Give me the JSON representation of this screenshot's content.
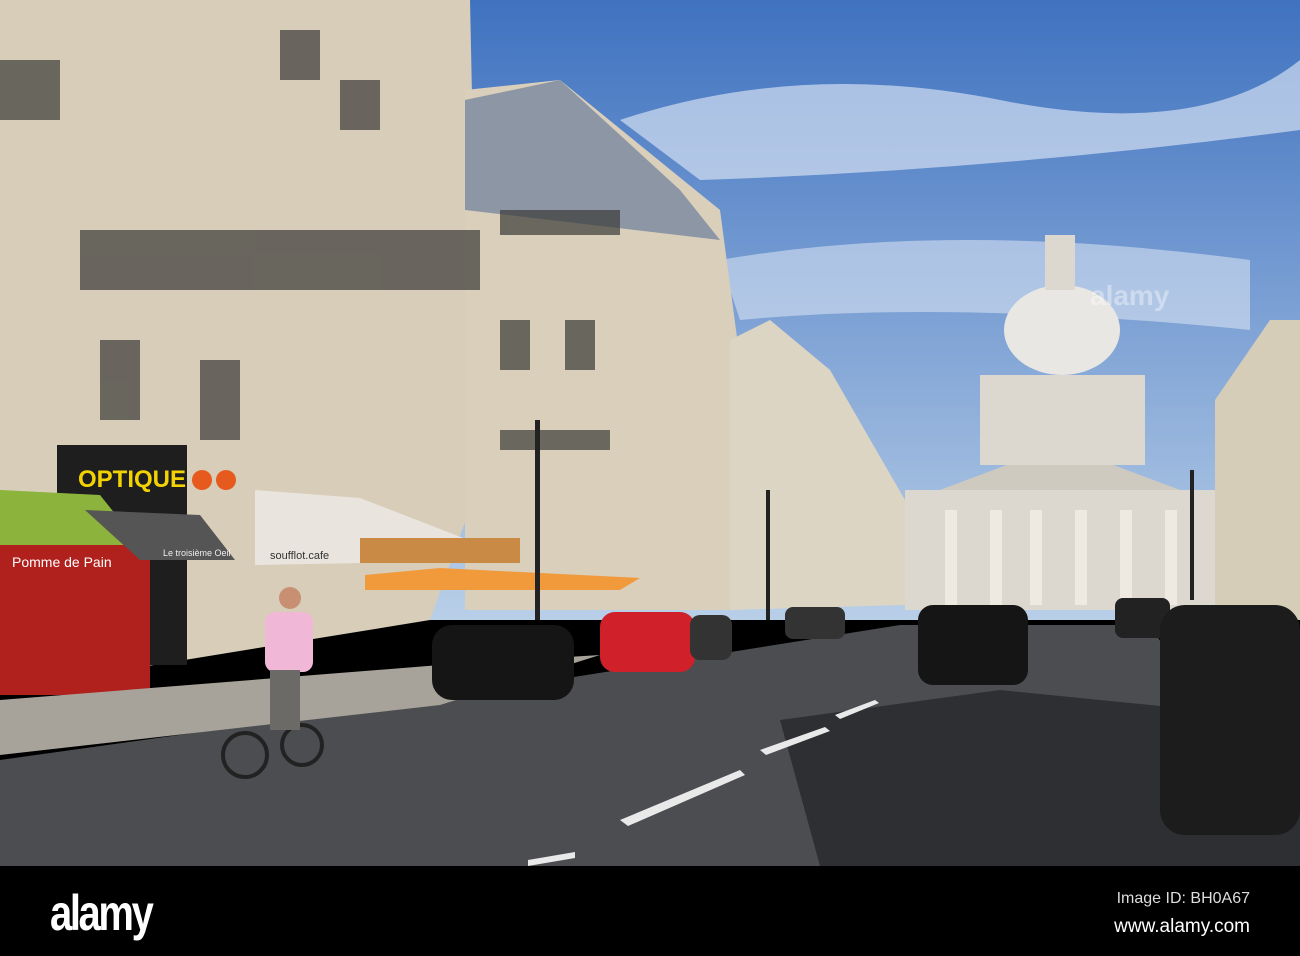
{
  "photo": {
    "signs": {
      "optique": "OPTIQUE",
      "pomme_de_pain": "Pomme de Pain",
      "troisieme_oeil": "Le troisième Oeil",
      "soufflot_cafe": "soufflot.cafe"
    },
    "watermark": "alamy"
  },
  "footer": {
    "logo": "alamy",
    "image_id": "Image ID: BH0A67",
    "url": "www.alamy.com"
  }
}
